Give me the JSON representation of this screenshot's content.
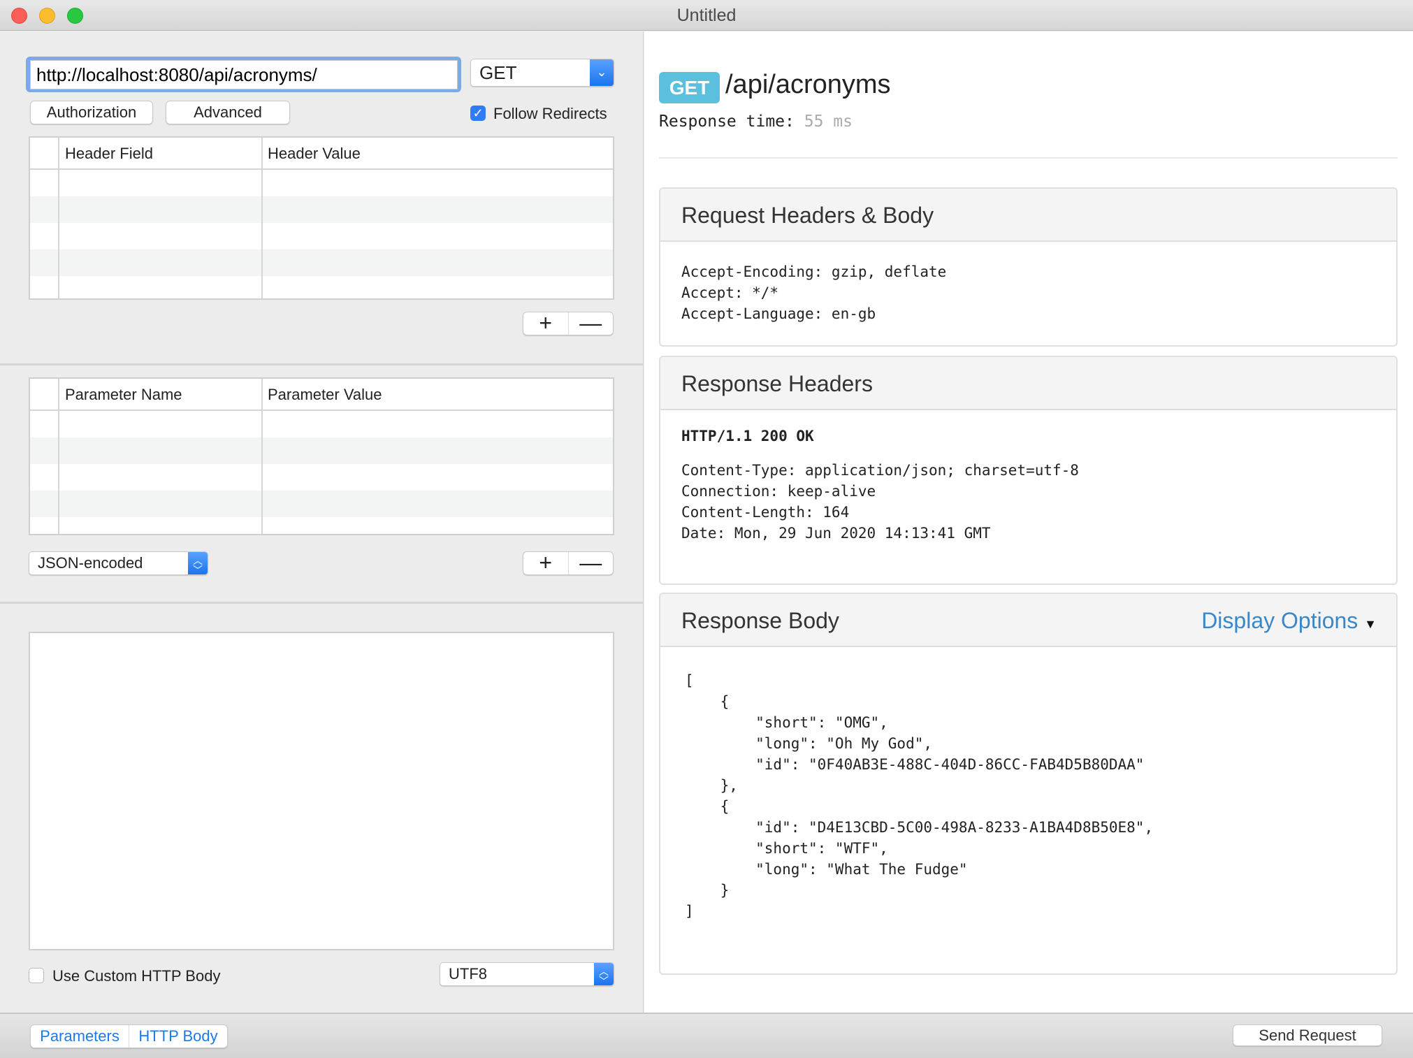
{
  "window": {
    "title": "Untitled"
  },
  "request": {
    "url": "http://localhost:8080/api/acronyms/",
    "method": "GET",
    "authorization_label": "Authorization",
    "advanced_label": "Advanced",
    "follow_redirects_label": "Follow Redirects",
    "follow_redirects_checked": true,
    "headers_table": {
      "columns": [
        "Header Field",
        "Header Value"
      ],
      "rows": []
    },
    "params_table": {
      "columns": [
        "Parameter Name",
        "Parameter Value"
      ],
      "rows": []
    },
    "add_symbol": "+",
    "remove_symbol": "—",
    "encoding_select": "JSON-encoded",
    "body_text": "",
    "use_custom_body_label": "Use Custom HTTP Body",
    "use_custom_body_checked": false,
    "charset_select": "UTF8"
  },
  "bottom": {
    "tabs": [
      {
        "label": "Parameters"
      },
      {
        "label": "HTTP Body"
      }
    ],
    "send_label": "Send Request"
  },
  "response": {
    "method_badge": "GET",
    "path": "/api/acronyms",
    "time_label": "Response time:",
    "time_value": "55 ms",
    "request_panel": {
      "title": "Request Headers & Body",
      "body": "Accept-Encoding: gzip, deflate\nAccept: */*\nAccept-Language: en-gb"
    },
    "headers_panel": {
      "title": "Response Headers",
      "status": "HTTP/1.1 200 OK",
      "body": "Content-Type: application/json; charset=utf-8\nConnection: keep-alive\nContent-Length: 164\nDate: Mon, 29 Jun 2020 14:13:41 GMT"
    },
    "body_panel": {
      "title": "Response Body",
      "display_options": "Display Options",
      "body": "[\n    {\n        \"short\": \"OMG\",\n        \"long\": \"Oh My God\",\n        \"id\": \"0F40AB3E-488C-404D-86CC-FAB4D5B80DAA\"\n    },\n    {\n        \"id\": \"D4E13CBD-5C00-498A-8233-A1BA4D8B50E8\",\n        \"short\": \"WTF\",\n        \"long\": \"What The Fudge\"\n    }\n]"
    }
  },
  "colors": {
    "accent": "#1a73f0",
    "badge": "#5bc0de",
    "link": "#3a87c8"
  }
}
